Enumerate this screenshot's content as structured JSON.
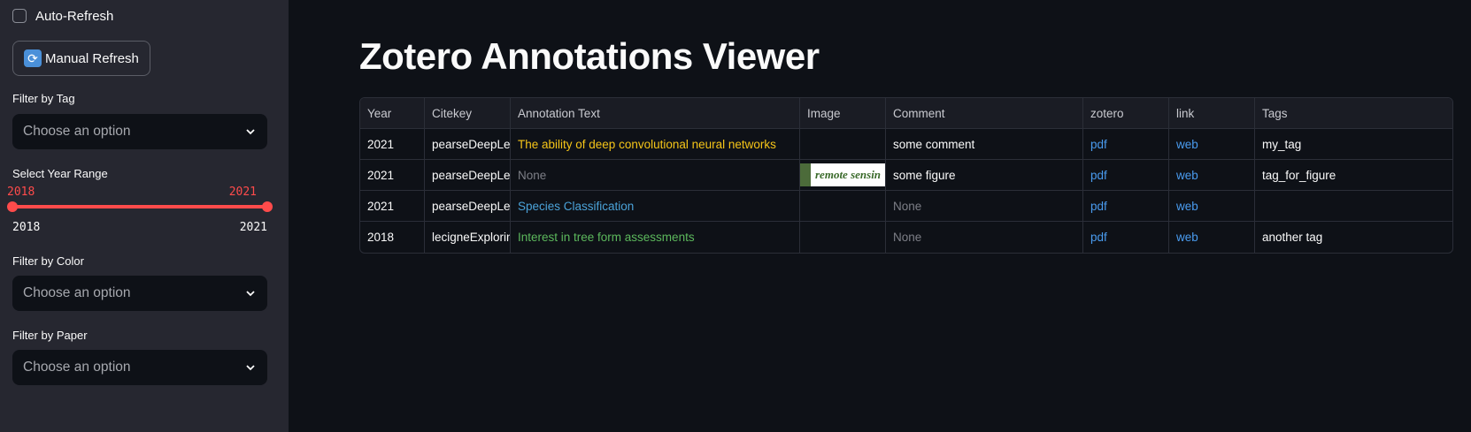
{
  "sidebar": {
    "auto_refresh_label": "Auto-Refresh",
    "manual_refresh_label": "Manual Refresh",
    "manual_refresh_icon": "🔄",
    "filter_tag": {
      "label": "Filter by Tag",
      "value": "Choose an option"
    },
    "year_range": {
      "label": "Select Year Range",
      "low": "2018",
      "high": "2021",
      "min": "2018",
      "max": "2021"
    },
    "filter_color": {
      "label": "Filter by Color",
      "value": "Choose an option"
    },
    "filter_paper": {
      "label": "Filter by Paper",
      "value": "Choose an option"
    }
  },
  "main": {
    "title": "Zotero Annotations Viewer",
    "table": {
      "columns": [
        "Year",
        "Citekey",
        "Annotation Text",
        "Image",
        "Comment",
        "zotero",
        "link",
        "Tags"
      ],
      "rows": [
        {
          "year": "2021",
          "citekey": "pearseDeepLea",
          "text": "The ability of deep convolutional neural networks",
          "text_color": "#f5c518",
          "image": "",
          "comment": "some comment",
          "zotero": "pdf",
          "link": "web",
          "tags": "my_tag"
        },
        {
          "year": "2021",
          "citekey": "pearseDeepLea",
          "text": "None",
          "text_color": "#7d7f87",
          "image": "remote sensin",
          "comment": "some figure",
          "zotero": "pdf",
          "link": "web",
          "tags": "tag_for_figure"
        },
        {
          "year": "2021",
          "citekey": "pearseDeepLea",
          "text": "Species Classification",
          "text_color": "#4ba3d9",
          "image": "",
          "comment": "None",
          "zotero": "pdf",
          "link": "web",
          "tags": ""
        },
        {
          "year": "2018",
          "citekey": "lecigneExplorin",
          "text": "Interest in tree form assessments",
          "text_color": "#5cb85c",
          "image": "",
          "comment": "None",
          "zotero": "pdf",
          "link": "web",
          "tags": "another tag"
        }
      ]
    }
  },
  "colors": {
    "accent": "#ff4b4b",
    "link": "#4a9cf0",
    "background": "#0e1117",
    "sidebar": "#262730"
  }
}
